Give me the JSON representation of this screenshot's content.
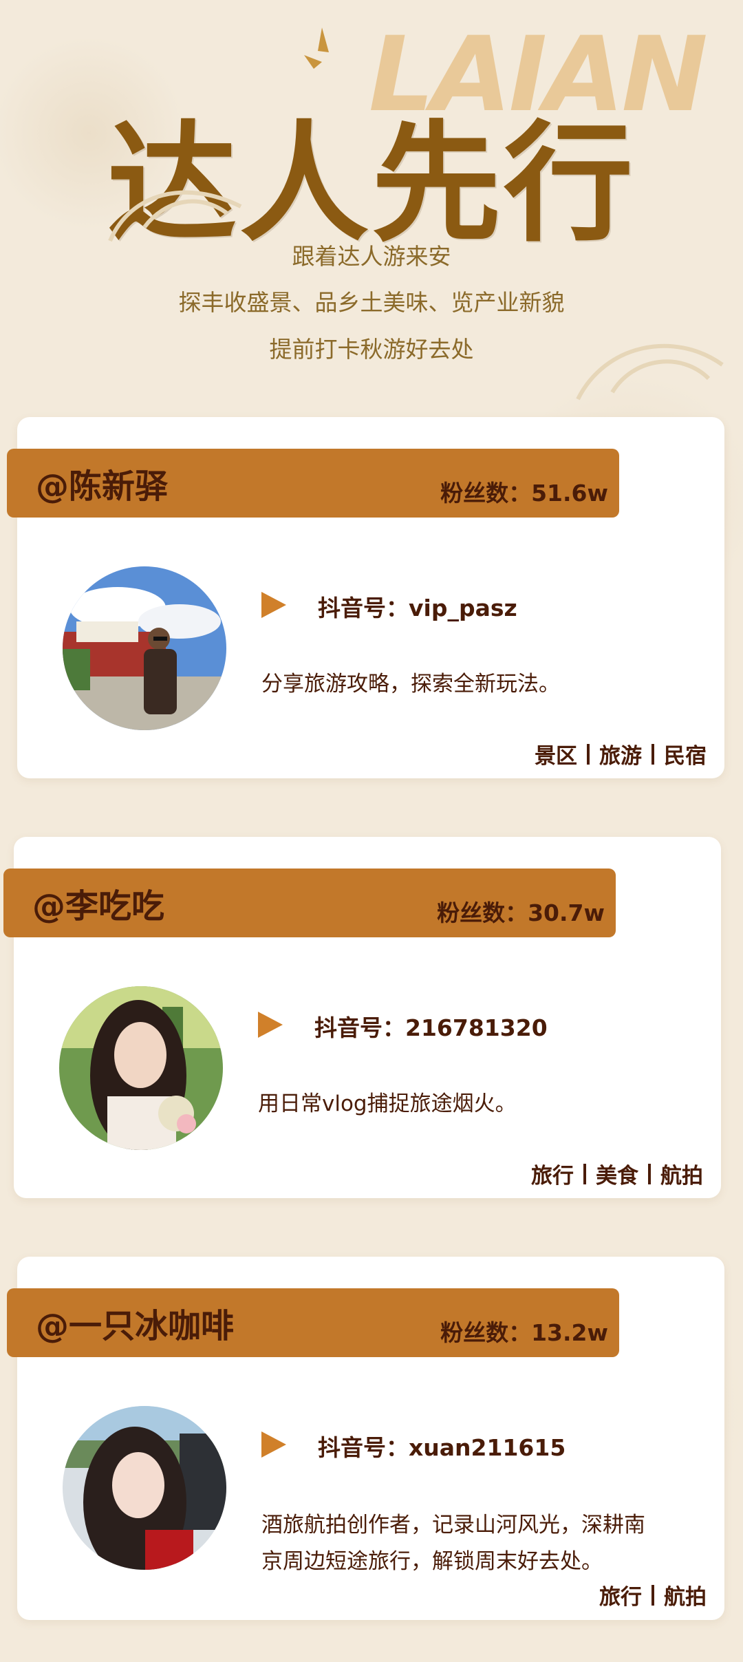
{
  "header": {
    "brand_word": "LAIAN",
    "title": "达人先行",
    "subtitle_lines": [
      "跟着达人游来安",
      "探丰收盛景、品乡土美味、览产业新貌",
      "提前打卡秋游好去处"
    ]
  },
  "colors": {
    "background": "#f3eadb",
    "title": "#8b5a12",
    "banner": "#c2782a",
    "text_dark": "#4a1c08",
    "play_icon": "#d0802a"
  },
  "creators": [
    {
      "handle": "@陈新驿",
      "fans": "粉丝数：51.6w",
      "douyin_id": "抖音号：vip_pasz",
      "description": [
        "分享旅游攻略，探索全新玩法。"
      ],
      "tags": [
        "景区",
        "旅游",
        "民宿"
      ],
      "avatar_icon": "man-at-potala-palace-photo"
    },
    {
      "handle": "@李吃吃",
      "fans": "粉丝数：30.7w",
      "douyin_id": "抖音号：216781320",
      "description": [
        "用日常vlog捕捉旅途烟火。"
      ],
      "tags": [
        "旅行",
        "美食",
        "航拍"
      ],
      "avatar_icon": "woman-with-flowers-photo"
    },
    {
      "handle": "@一只冰咖啡",
      "fans": "粉丝数：13.2w",
      "douyin_id": "抖音号：xuan211615",
      "description": [
        "酒旅航拍创作者，记录山河风光，深耕南",
        "京周边短途旅行，解锁周末好去处。"
      ],
      "tags": [
        "旅行",
        "航拍"
      ],
      "avatar_icon": "woman-in-car-photo"
    }
  ]
}
